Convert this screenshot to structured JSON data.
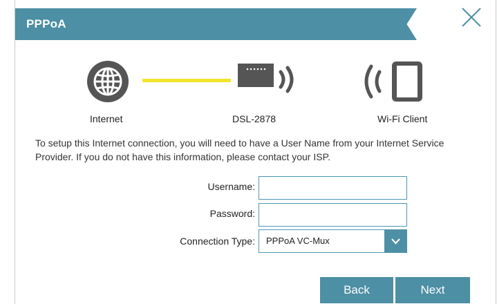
{
  "dialog": {
    "title": "PPPoA"
  },
  "diagram": {
    "internet_label": "Internet",
    "router_label": "DSL-2878",
    "client_label": "Wi-Fi Client",
    "link_color": "#f2e52b"
  },
  "instructions": "To setup this Internet connection, you will need to have a User Name from your Internet Service Provider. If you do not have this information, please contact your ISP.",
  "form": {
    "username_label": "Username:",
    "username_value": "",
    "password_label": "Password:",
    "password_value": "",
    "connection_type_label": "Connection Type:",
    "connection_type_value": "PPPoA VC-Mux"
  },
  "buttons": {
    "back": "Back",
    "next": "Next"
  },
  "colors": {
    "accent": "#4d8fa4",
    "icon_gray": "#555555"
  }
}
